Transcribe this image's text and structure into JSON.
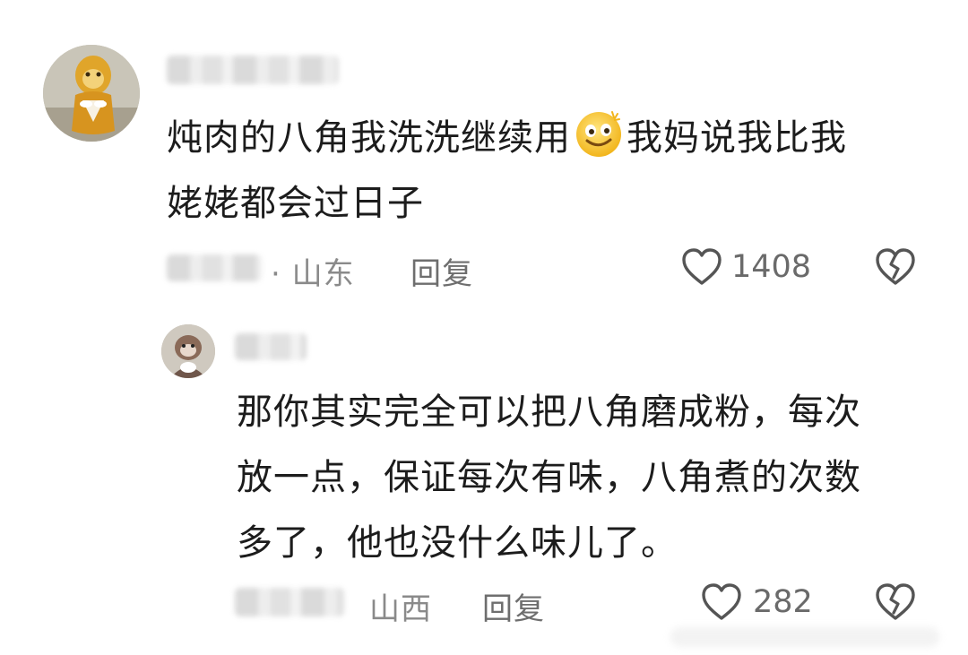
{
  "comments": [
    {
      "text_before_emoji": "炖肉的八角我洗洗继续用",
      "emoji": "smiling-face-emoji",
      "text_after_emoji": "我妈说我比我",
      "text_line2": "姥姥都会过日子",
      "location": "· 山东",
      "reply_label": "回复",
      "like_count": "1408"
    },
    {
      "text_lines": [
        "那你其实完全可以把八角磨成粉，每次",
        "放一点，保证每次有味，八角煮的次数",
        "多了，他也没什么味儿了。"
      ],
      "location": "山西",
      "reply_label": "回复",
      "like_count": "282"
    }
  ]
}
